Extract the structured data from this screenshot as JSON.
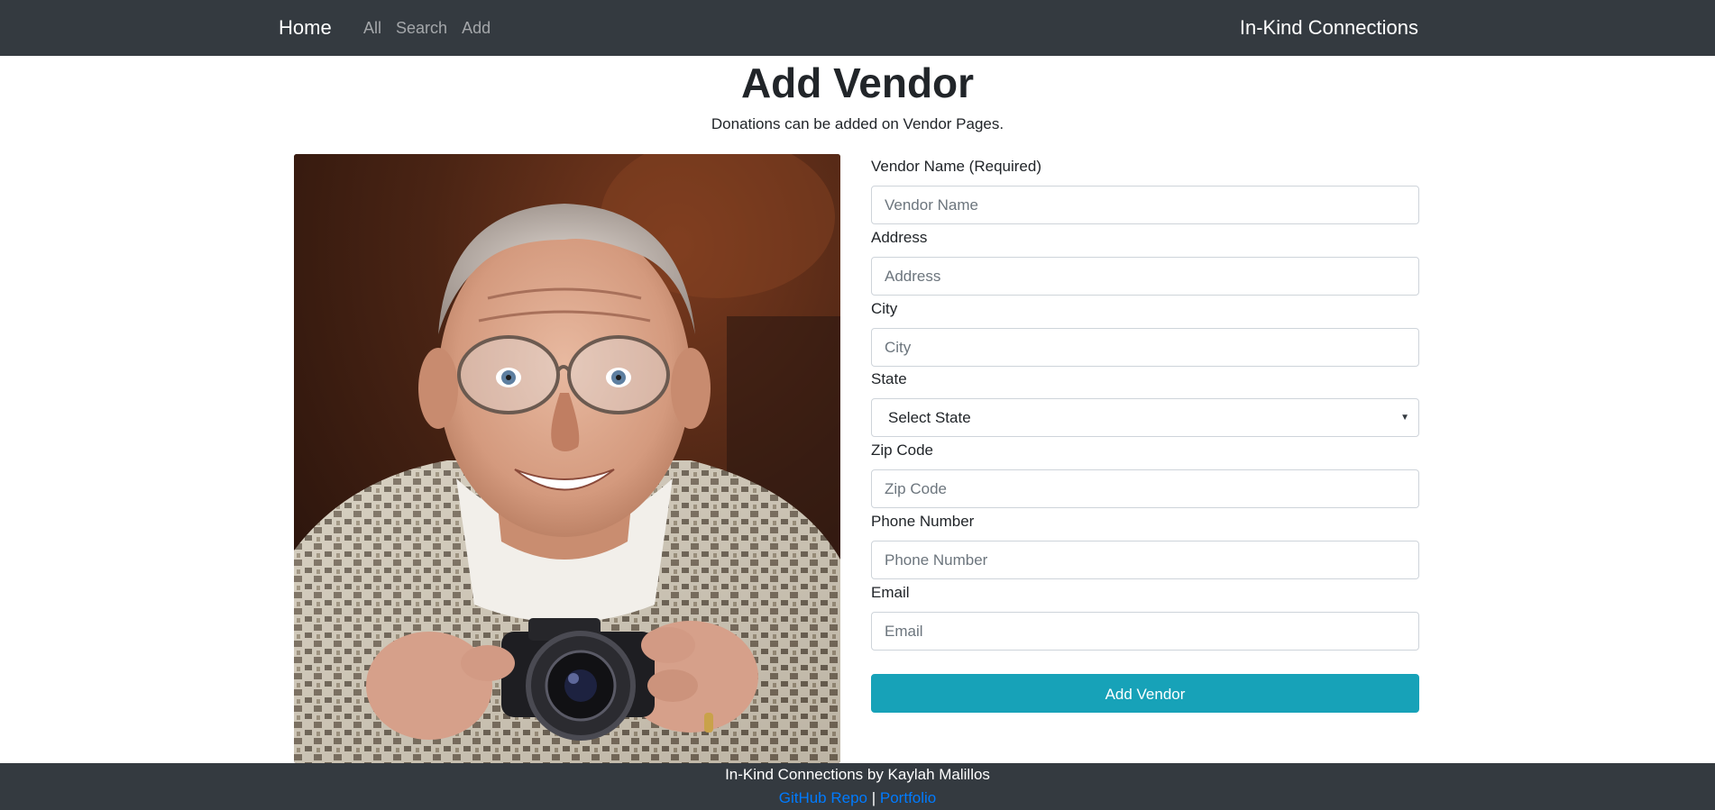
{
  "navbar": {
    "brand": "Home",
    "links": [
      "All",
      "Search",
      "Add"
    ],
    "app_title": "In-Kind Connections"
  },
  "main": {
    "title": "Add Vendor",
    "subtitle": "Donations can be added on Vendor Pages."
  },
  "form": {
    "fields": [
      {
        "label": "Vendor Name (Required)",
        "placeholder": "Vendor Name"
      },
      {
        "label": "Address",
        "placeholder": "Address"
      },
      {
        "label": "City",
        "placeholder": "City"
      },
      {
        "label": "State",
        "selected": "Select State"
      },
      {
        "label": "Zip Code",
        "placeholder": "Zip Code"
      },
      {
        "label": "Phone Number",
        "placeholder": "Phone Number"
      },
      {
        "label": "Email",
        "placeholder": "Email"
      }
    ],
    "submit_label": "Add Vendor"
  },
  "footer": {
    "credit": "In-Kind Connections by Kaylah Malillos",
    "links": [
      "GitHub Repo",
      "Portfolio"
    ],
    "separator": "|"
  },
  "colors": {
    "navbar_bg": "#343a40",
    "button_bg": "#17a2b8",
    "link": "#007bff"
  }
}
